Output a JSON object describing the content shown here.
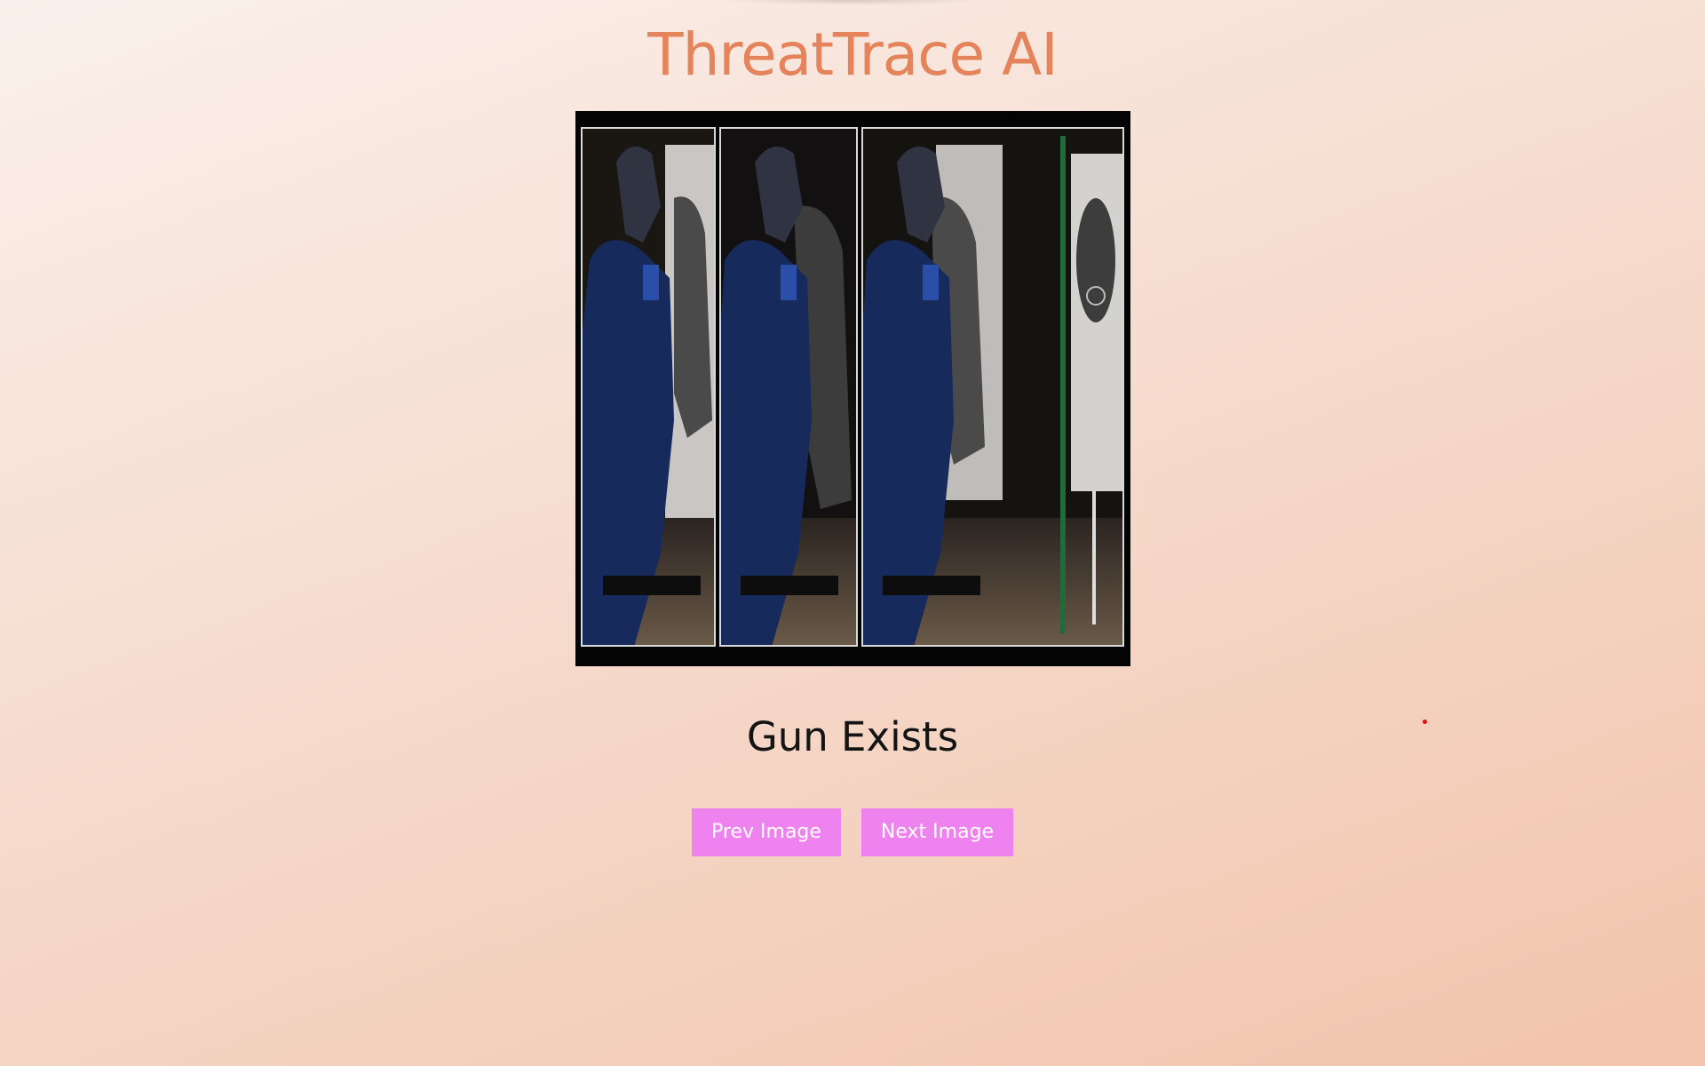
{
  "app": {
    "title": "ThreatTrace AI"
  },
  "viewer": {
    "image_description": "Three side-by-side frames of an officer in dark blue uniform and ear protection aiming a handgun at a shooting-range target"
  },
  "result": {
    "label": "Gun Exists"
  },
  "controls": {
    "prev_label": "Prev Image",
    "next_label": "Next Image"
  },
  "colors": {
    "title": "#e5835a",
    "button_bg": "#ee82ee",
    "button_text": "#ffffff",
    "viewer_frame": "#040404"
  }
}
